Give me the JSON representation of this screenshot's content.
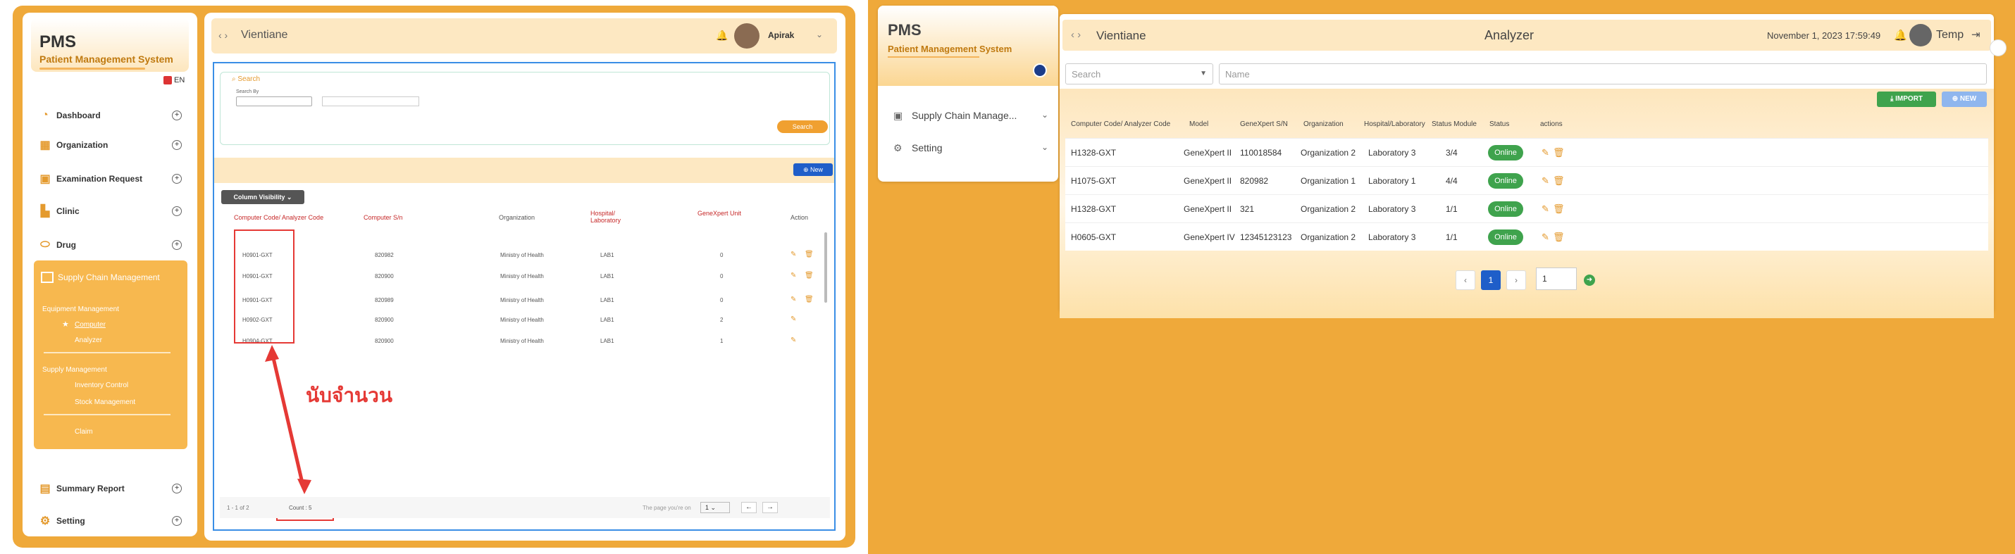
{
  "left": {
    "brand": {
      "title": "PMS",
      "subtitle": "Patient Management System"
    },
    "lang": "EN",
    "menu": [
      {
        "label": "Dashboard",
        "icon": "dashboard-icon"
      },
      {
        "label": "Organization",
        "icon": "organization-icon"
      },
      {
        "label": "Examination Request",
        "icon": "examination-icon"
      },
      {
        "label": "Clinic",
        "icon": "clinic-icon"
      },
      {
        "label": "Drug",
        "icon": "drug-icon"
      }
    ],
    "supply_chain": {
      "label": "Supply Chain Management",
      "group1": "Equipment Management",
      "sub1": "Computer",
      "sub2": "Analyzer",
      "group2": "Supply Management",
      "sub3": "Inventory Control",
      "sub4": "Stock Management",
      "sub5": "Claim"
    },
    "menu_bottom": [
      {
        "label": "Summary Report",
        "icon": "report-icon"
      },
      {
        "label": "Setting",
        "icon": "gear-icon"
      }
    ],
    "topbar": {
      "title": "Vientiane",
      "user": "Apirak"
    },
    "search": {
      "label": "Search",
      "search_by": "Search By",
      "button": "Search"
    },
    "new_button": "New",
    "column_visibility": "Column Visibility",
    "columns": [
      "Computer Code/ Analyzer Code",
      "Computer S/n",
      "Organization",
      "Hospital/ Laboratory",
      "GeneXpert Unit",
      "Action"
    ],
    "rows": [
      {
        "code": "H0901-GXT",
        "sn": "820982",
        "org": "Ministry of Health",
        "lab": "LAB1",
        "unit": "0"
      },
      {
        "code": "H0901-GXT",
        "sn": "820900",
        "org": "Ministry of Health",
        "lab": "LAB1",
        "unit": "0"
      },
      {
        "code": "H0901-GXT",
        "sn": "820989",
        "org": "Ministry of Health",
        "lab": "LAB1",
        "unit": "0"
      },
      {
        "code": "H0902-GXT",
        "sn": "820900",
        "org": "Ministry of Health",
        "lab": "LAB1",
        "unit": "2"
      },
      {
        "code": "H0904-GXT",
        "sn": "820900",
        "org": "Ministry of Health",
        "lab": "LAB1",
        "unit": "1"
      }
    ],
    "annotation": "นับจำนวน",
    "footer": {
      "paging": "1 - 1 of 2",
      "count": "Count : 5",
      "page_label": "The page you're on",
      "page": "1"
    }
  },
  "right": {
    "brand": {
      "title": "PMS",
      "subtitle": "Patient Management System"
    },
    "menu": [
      {
        "label": "Supply Chain Manage...",
        "icon": "supply-chain-icon"
      },
      {
        "label": "Setting",
        "icon": "gear-icon"
      }
    ],
    "topbar": {
      "title": "Vientiane",
      "page": "Analyzer",
      "datetime": "November 1, 2023 17:59:49",
      "user": "Temp"
    },
    "search_placeholder": "Search",
    "name_placeholder": "Name",
    "import_button": "IMPORT",
    "new_button": "NEW",
    "columns": [
      "Computer Code/ Analyzer Code",
      "Model",
      "GeneXpert S/N",
      "Organization",
      "Hospital/Laboratory",
      "Status Module",
      "Status",
      "actions"
    ],
    "rows": [
      {
        "code": "H1328-GXT",
        "model": "GeneXpert II",
        "sn": "110018584",
        "org": "Organization 2",
        "lab": "Laboratory 3",
        "module": "3/4",
        "status": "Online"
      },
      {
        "code": "H1075-GXT",
        "model": "GeneXpert II",
        "sn": "820982",
        "org": "Organization 1",
        "lab": "Laboratory 1",
        "module": "4/4",
        "status": "Online"
      },
      {
        "code": "H1328-GXT",
        "model": "GeneXpert II",
        "sn": "321",
        "org": "Organization 2",
        "lab": "Laboratory 3",
        "module": "1/1",
        "status": "Online"
      },
      {
        "code": "H0605-GXT",
        "model": "GeneXpert IV",
        "sn": "12345123123",
        "org": "Organization 2",
        "lab": "Laboratory 3",
        "module": "1/1",
        "status": "Online"
      }
    ],
    "pager": {
      "current": "1",
      "input": "1"
    },
    "colors": {
      "accent": "#efa93a",
      "online": "#3fa34d",
      "primary": "#1f5ec9"
    }
  }
}
